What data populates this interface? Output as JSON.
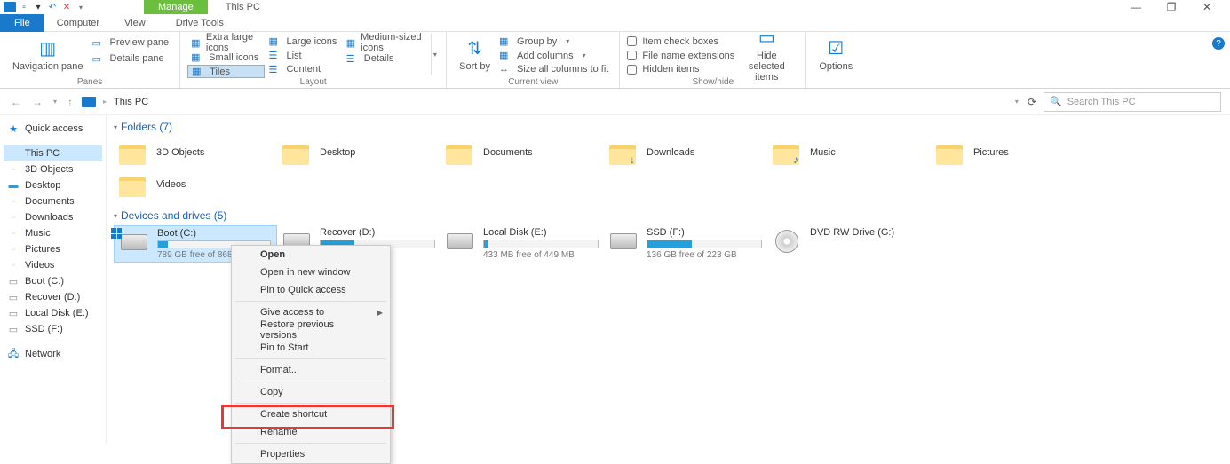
{
  "window": {
    "title": "This PC",
    "manage_tab": "Manage"
  },
  "tabs": {
    "file": "File",
    "computer": "Computer",
    "view": "View",
    "drive_tools": "Drive Tools"
  },
  "ribbon": {
    "panes": {
      "navigation": "Navigation pane",
      "preview": "Preview pane",
      "details": "Details pane",
      "label": "Panes"
    },
    "layout": {
      "extra_large": "Extra large icons",
      "large": "Large icons",
      "medium": "Medium-sized icons",
      "small": "Small icons",
      "list": "List",
      "details": "Details",
      "tiles": "Tiles",
      "content": "Content",
      "label": "Layout"
    },
    "sort": {
      "btn": "Sort by"
    },
    "current_view": {
      "group_by": "Group by",
      "add_columns": "Add columns",
      "size_all": "Size all columns to fit",
      "label": "Current view"
    },
    "show_hide": {
      "item_check": "Item check boxes",
      "file_ext": "File name extensions",
      "hidden": "Hidden items",
      "hide_selected": "Hide selected items",
      "label": "Show/hide"
    },
    "options": "Options"
  },
  "address": {
    "location": "This PC",
    "search_placeholder": "Search This PC"
  },
  "sidebar": {
    "quick_access": "Quick access",
    "this_pc": "This PC",
    "objects3d": "3D Objects",
    "desktop": "Desktop",
    "documents": "Documents",
    "downloads": "Downloads",
    "music": "Music",
    "pictures": "Pictures",
    "videos": "Videos",
    "boot": "Boot (C:)",
    "recover": "Recover (D:)",
    "local_e": "Local Disk (E:)",
    "ssd": "SSD (F:)",
    "network": "Network"
  },
  "sections": {
    "folders": "Folders (7)",
    "devices": "Devices and drives (5)"
  },
  "folders": [
    {
      "name": "3D Objects",
      "badge": ""
    },
    {
      "name": "Desktop",
      "badge": ""
    },
    {
      "name": "Documents",
      "badge": ""
    },
    {
      "name": "Downloads",
      "badge": "↓"
    },
    {
      "name": "Music",
      "badge": "♪"
    },
    {
      "name": "Pictures",
      "badge": ""
    },
    {
      "name": "Videos",
      "badge": ""
    }
  ],
  "drives": [
    {
      "name": "Boot (C:)",
      "free": "789 GB free of 868 GB",
      "fill": 9,
      "selected": true,
      "winlogo": true
    },
    {
      "name": "Recover (D:)",
      "free": "",
      "fill": 30,
      "selected": false
    },
    {
      "name": "Local Disk (E:)",
      "free": "433 MB free of 449 MB",
      "fill": 4,
      "selected": false
    },
    {
      "name": "SSD (F:)",
      "free": "136 GB free of 223 GB",
      "fill": 39,
      "selected": false
    },
    {
      "name": "DVD RW Drive (G:)",
      "free": "",
      "fill": null,
      "selected": false,
      "dvd": true
    }
  ],
  "context_menu": [
    {
      "label": "Open",
      "bold": true
    },
    {
      "label": "Open in new window"
    },
    {
      "label": "Pin to Quick access"
    },
    {
      "sep": true
    },
    {
      "label": "Give access to",
      "sub": true
    },
    {
      "label": "Restore previous versions"
    },
    {
      "label": "Pin to Start"
    },
    {
      "sep": true
    },
    {
      "label": "Format..."
    },
    {
      "sep": true
    },
    {
      "label": "Copy"
    },
    {
      "sep": true
    },
    {
      "label": "Create shortcut"
    },
    {
      "label": "Rename"
    },
    {
      "sep": true
    },
    {
      "label": "Properties",
      "highlight": true
    }
  ]
}
